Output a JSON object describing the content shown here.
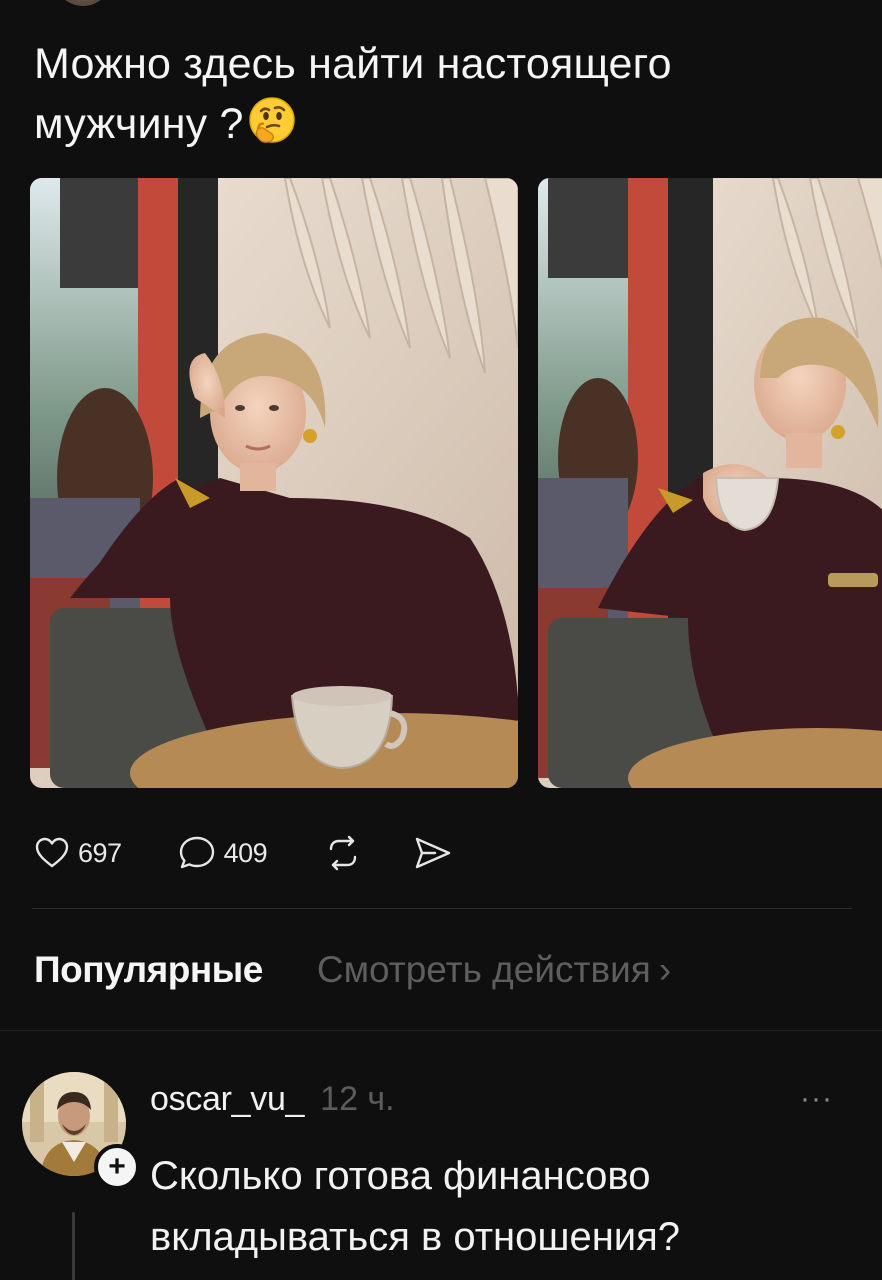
{
  "post": {
    "text": "Можно здесь найти настоящего мужчину ?"
  },
  "gallery": {
    "photos": [
      {
        "alt": "photo-1"
      },
      {
        "alt": "photo-2"
      }
    ]
  },
  "actions": {
    "likes": "697",
    "comments": "409"
  },
  "tabs": {
    "popular": "Популярные",
    "activity": "Смотреть действия",
    "activity_chevron": "›"
  },
  "comment": {
    "username": "oscar_vu_",
    "time": "12 ч.",
    "more": "···",
    "follow": "+",
    "text": "Сколько готова финансово вкладываться в отношения?"
  },
  "icons": {
    "emoji": "thinking-face-icon",
    "like": "heart-icon",
    "comment": "comment-bubble-icon",
    "repost": "repost-icon",
    "share": "send-icon"
  },
  "colors": {
    "background": "#0f0f0f",
    "text": "#f5f5f5",
    "muted": "#5e5e5e"
  }
}
